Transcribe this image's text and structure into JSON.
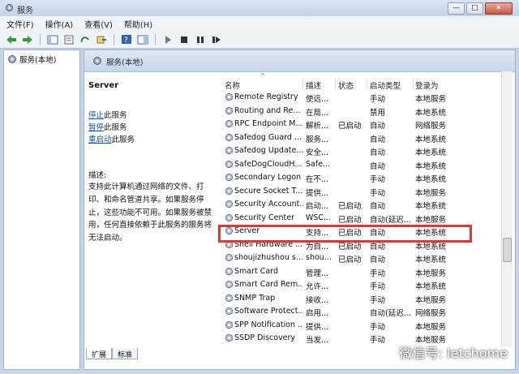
{
  "window": {
    "title": "服务"
  },
  "menu": [
    "文件(F)",
    "操作(A)",
    "查看(V)",
    "帮助(H)"
  ],
  "tree": {
    "root": "服务(本地)"
  },
  "pane": {
    "title": "服务(本地)"
  },
  "selected": {
    "name": "Server",
    "links": [
      {
        "u": "停止",
        "rest": "此服务"
      },
      {
        "u": "暂停",
        "rest": "此服务"
      },
      {
        "u": "重启动",
        "rest": "此服务"
      }
    ],
    "desc_label": "描述:",
    "description": "支持此计算机通过网络的文件、打印、和命名管道共享。如果服务停止，这些功能不可用。如果服务被禁用，任何直接依赖于此服务的服务将无法启动。"
  },
  "columns": [
    "名称",
    "描述",
    "状态",
    "启动类型",
    "登录为"
  ],
  "rows": [
    {
      "name": "Remote Registry",
      "desc": "使远...",
      "status": "",
      "start": "手动",
      "logon": "本地服务"
    },
    {
      "name": "Routing and Re...",
      "desc": "在局...",
      "status": "",
      "start": "禁用",
      "logon": "本地系统"
    },
    {
      "name": "RPC Endpoint M...",
      "desc": "解析...",
      "status": "已启动",
      "start": "自动",
      "logon": "网络服务"
    },
    {
      "name": "Safedog Guard ...",
      "desc": "服务...",
      "status": "",
      "start": "自动",
      "logon": "本地系统"
    },
    {
      "name": "Safedog Update...",
      "desc": "安全...",
      "status": "",
      "start": "自动",
      "logon": "本地系统"
    },
    {
      "name": "SafeDogCloudH...",
      "desc": "Safe...",
      "status": "",
      "start": "自动",
      "logon": "本地系统"
    },
    {
      "name": "Secondary Logon",
      "desc": "在不...",
      "status": "",
      "start": "手动",
      "logon": "本地系统"
    },
    {
      "name": "Secure Socket T...",
      "desc": "提供...",
      "status": "",
      "start": "手动",
      "logon": "本地服务"
    },
    {
      "name": "Security Account...",
      "desc": "启动...",
      "status": "已启动",
      "start": "自动",
      "logon": "本地系统"
    },
    {
      "name": "Security Center",
      "desc": "WSC...",
      "status": "已启动",
      "start": "自动(延迟...",
      "logon": "本地服务"
    },
    {
      "name": "Server",
      "desc": "支持...",
      "status": "已启动",
      "start": "自动",
      "logon": "本地系统"
    },
    {
      "name": "Shell Hardware ...",
      "desc": "为自...",
      "status": "已启动",
      "start": "自动",
      "logon": "本地系统"
    },
    {
      "name": "shoujizhushou s...",
      "desc": "shou...",
      "status": "已启动",
      "start": "自动",
      "logon": "本地系统"
    },
    {
      "name": "Smart Card",
      "desc": "管理...",
      "status": "",
      "start": "手动",
      "logon": "本地服务"
    },
    {
      "name": "Smart Card Rem...",
      "desc": "允许...",
      "status": "",
      "start": "手动",
      "logon": "本地系统"
    },
    {
      "name": "SNMP Trap",
      "desc": "接收...",
      "status": "",
      "start": "手动",
      "logon": "本地服务"
    },
    {
      "name": "Software Protect...",
      "desc": "启用...",
      "status": "",
      "start": "自动(延迟...",
      "logon": "网络服务"
    },
    {
      "name": "SPP Notification ...",
      "desc": "提供...",
      "status": "",
      "start": "手动",
      "logon": "本地服务"
    },
    {
      "name": "SSDP Discovery",
      "desc": "当发...",
      "status": "",
      "start": "手动",
      "logon": "本地服务"
    }
  ],
  "tabs": [
    "扩展",
    "标准"
  ],
  "watermark": "微信号: Ietchome",
  "colors": {
    "highlight": "#d63b3b",
    "link": "#1a55b0"
  }
}
